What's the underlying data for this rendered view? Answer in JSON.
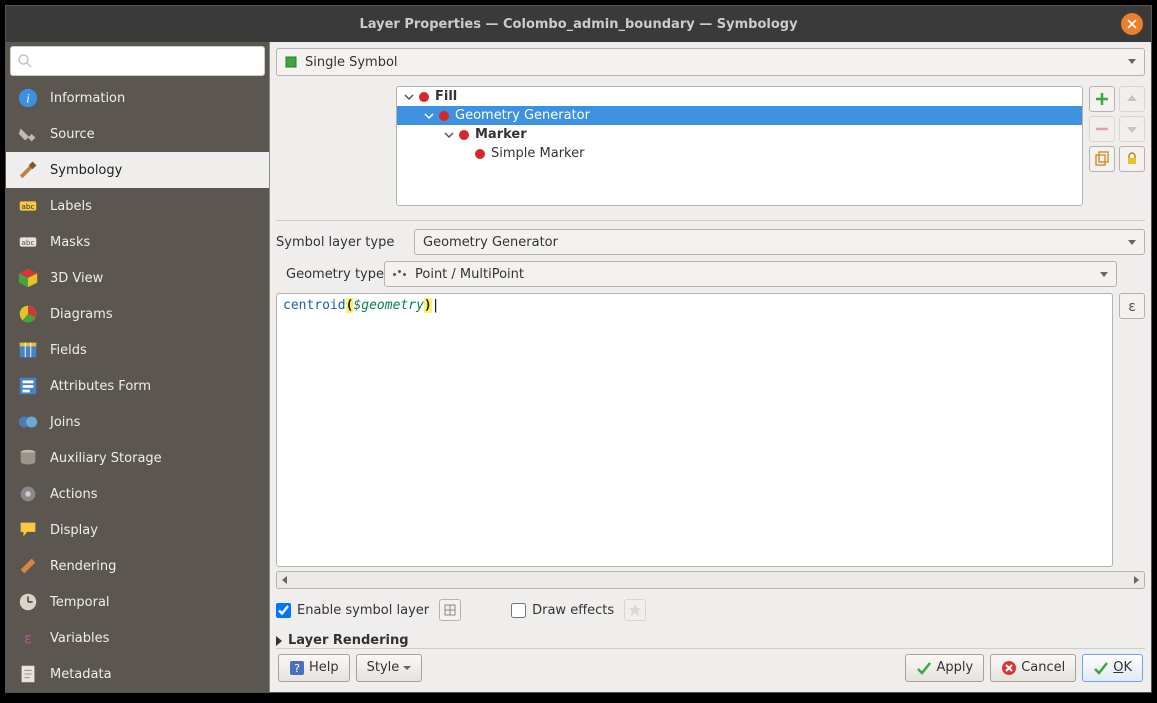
{
  "window": {
    "title": "Layer Properties — Colombo_admin_boundary — Symbology"
  },
  "sidebar": {
    "search_placeholder": "",
    "items": [
      {
        "label": "Information"
      },
      {
        "label": "Source"
      },
      {
        "label": "Symbology"
      },
      {
        "label": "Labels"
      },
      {
        "label": "Masks"
      },
      {
        "label": "3D View"
      },
      {
        "label": "Diagrams"
      },
      {
        "label": "Fields"
      },
      {
        "label": "Attributes Form"
      },
      {
        "label": "Joins"
      },
      {
        "label": "Auxiliary Storage"
      },
      {
        "label": "Actions"
      },
      {
        "label": "Display"
      },
      {
        "label": "Rendering"
      },
      {
        "label": "Temporal"
      },
      {
        "label": "Variables"
      },
      {
        "label": "Metadata"
      }
    ],
    "active_index": 2
  },
  "symbol": {
    "type_label": "Single Symbol",
    "tree": [
      {
        "label": "Fill",
        "level": 0,
        "expandable": true,
        "bold": true,
        "selected": false
      },
      {
        "label": "Geometry Generator",
        "level": 1,
        "expandable": true,
        "bold": false,
        "selected": true
      },
      {
        "label": "Marker",
        "level": 2,
        "expandable": true,
        "bold": true,
        "selected": false
      },
      {
        "label": "Simple Marker",
        "level": 3,
        "expandable": false,
        "bold": false,
        "selected": false
      }
    ]
  },
  "form": {
    "symbol_layer_type_label": "Symbol layer type",
    "symbol_layer_type_value": "Geometry Generator",
    "geometry_type_label": "Geometry type",
    "geometry_type_value": "Point / MultiPoint",
    "expression": {
      "func": "centroid",
      "var": "$geometry"
    }
  },
  "checks": {
    "enable_symbol_layer_label": "Enable symbol layer",
    "enable_symbol_layer": true,
    "draw_effects_label": "Draw effects",
    "draw_effects": false
  },
  "collapse": {
    "layer_rendering": "Layer Rendering"
  },
  "buttons": {
    "help": "Help",
    "style": "Style",
    "apply": "Apply",
    "cancel": "Cancel",
    "ok": "OK"
  }
}
